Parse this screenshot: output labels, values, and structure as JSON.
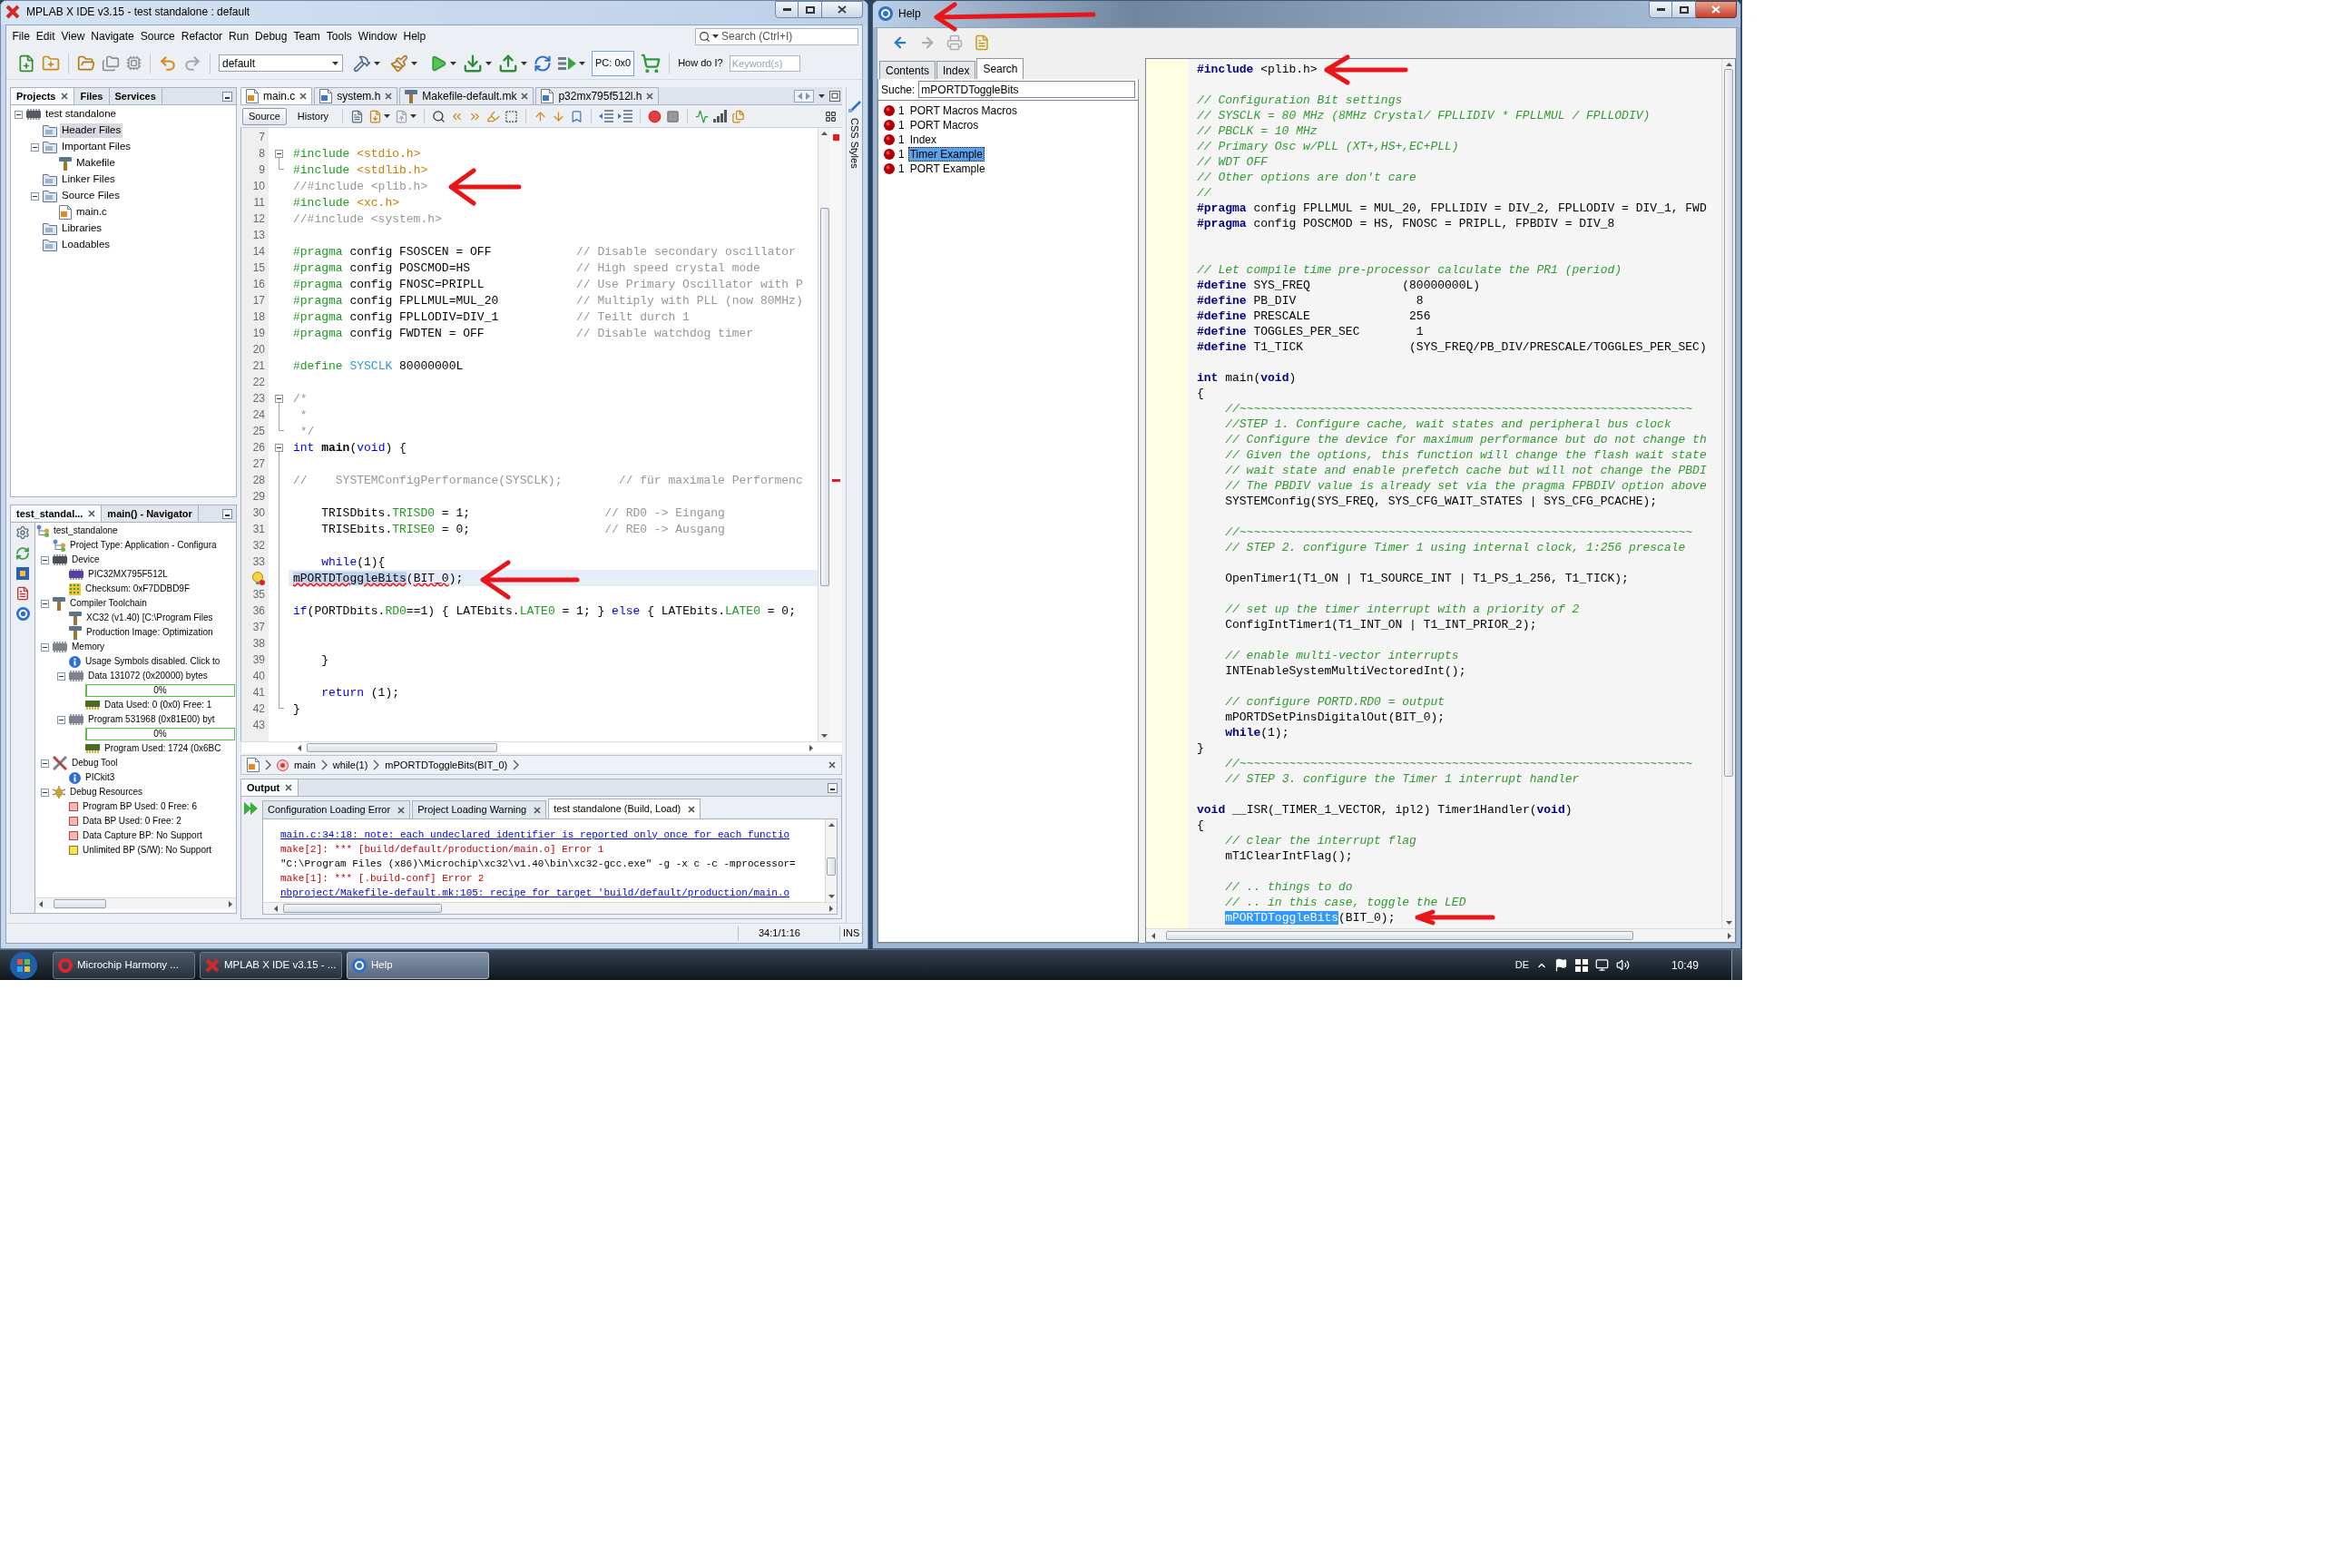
{
  "ide_window": {
    "active": false,
    "title": "MPLAB X IDE v3.15 - test standalone : default",
    "menu": [
      "File",
      "Edit",
      "View",
      "Navigate",
      "Source",
      "Refactor",
      "Run",
      "Debug",
      "Team",
      "Tools",
      "Window",
      "Help"
    ],
    "search": {
      "placeholder": "Search (Ctrl+I)"
    },
    "toolbar": {
      "configuration": "default",
      "pc": "PC: 0x0",
      "help_label": "How do I?",
      "keyword": {
        "placeholder": "Keyword(s)"
      }
    },
    "projects": {
      "tabs": [
        {
          "label": "Projects",
          "selected": true
        },
        {
          "label": "Files",
          "selected": false
        },
        {
          "label": "Services",
          "selected": false
        }
      ],
      "tree": [
        {
          "label": "test standalone",
          "kind": "project",
          "selected": false,
          "expanded": true,
          "children": [
            {
              "label": "Header Files",
              "kind": "folder",
              "selected": true
            },
            {
              "label": "Important Files",
              "kind": "folder",
              "selected": false,
              "expanded": true,
              "children": [
                {
                  "label": "Makefile",
                  "kind": "makefile",
                  "selected": false
                }
              ]
            },
            {
              "label": "Linker Files",
              "kind": "folder",
              "selected": false
            },
            {
              "label": "Source Files",
              "kind": "folder",
              "selected": false,
              "expanded": true,
              "children": [
                {
                  "label": "main.c",
                  "kind": "c-file",
                  "selected": false
                }
              ]
            },
            {
              "label": "Libraries",
              "kind": "folder",
              "selected": false
            },
            {
              "label": "Loadables",
              "kind": "folder",
              "selected": false
            }
          ]
        }
      ]
    },
    "dashboard": {
      "tabs": [
        {
          "label": "test_standal...",
          "selected": true
        },
        {
          "label": "main() - Navigator",
          "selected": false
        }
      ],
      "tree": [
        {
          "label": "test_standalone",
          "kind": "hierarchy",
          "children": [
            {
              "label": "Project Type: Application - Configura",
              "kind": "hierarchy"
            },
            {
              "label": "Device",
              "kind": "device",
              "expanded": true,
              "children": [
                {
                  "label": "PIC32MX795F512L",
                  "kind": "chip"
                },
                {
                  "label": "Checksum: 0xF7DDBD9F",
                  "kind": "checksum"
                }
              ]
            },
            {
              "label": "Compiler Toolchain",
              "kind": "toolchain",
              "expanded": true,
              "children": [
                {
                  "label": "XC32 (v1.40) [C:\\Program Files",
                  "kind": "toolchain"
                },
                {
                  "label": "Production Image: Optimization",
                  "kind": "toolchain"
                }
              ]
            },
            {
              "label": "Memory",
              "kind": "memory",
              "expanded": true,
              "children": [
                {
                  "label": "Usage Symbols disabled. Click to",
                  "kind": "info"
                },
                {
                  "label": "Data 131072 (0x20000) bytes",
                  "kind": "memory",
                  "expanded": true,
                  "children": [
                    {
                      "kind": "meter",
                      "level": 0,
                      "reading": "0%"
                    },
                    {
                      "label": "Data Used: 0 (0x0) Free: 1",
                      "kind": "usage"
                    }
                  ]
                },
                {
                  "label": "Program 531968 (0x81E00) byt",
                  "kind": "memory",
                  "expanded": true,
                  "children": [
                    {
                      "kind": "meter",
                      "level": 0,
                      "reading": "0%"
                    },
                    {
                      "label": "Program Used: 1724 (0x6BC",
                      "kind": "usage"
                    }
                  ]
                }
              ]
            },
            {
              "label": "Debug Tool",
              "kind": "debug-tool",
              "expanded": true,
              "children": [
                {
                  "label": "PICkit3",
                  "kind": "info"
                }
              ]
            },
            {
              "label": "Debug Resources",
              "kind": "bug",
              "expanded": true,
              "children": [
                {
                  "label": "Program BP Used: 0 Free: 6",
                  "kind": "breakpoint"
                },
                {
                  "label": "Data BP Used: 0 Free: 2",
                  "kind": "breakpoint"
                },
                {
                  "label": "Data Capture BP: No Support",
                  "kind": "breakpoint"
                },
                {
                  "label": "Unlimited BP (S/W): No Support",
                  "kind": "software-breakpoint"
                }
              ]
            }
          ]
        }
      ]
    },
    "editor": {
      "tabs": [
        {
          "label": "main.c",
          "kind": "c-file",
          "selected": true
        },
        {
          "label": "system.h",
          "kind": "header",
          "selected": false
        },
        {
          "label": "Makefile-default.mk",
          "kind": "makefile",
          "selected": false
        },
        {
          "label": "p32mx795f512l.h",
          "kind": "header",
          "selected": false
        }
      ],
      "views": [
        {
          "label": "Source",
          "selected": true
        },
        {
          "label": "History",
          "selected": false
        }
      ],
      "lines": [
        {
          "number": "7",
          "current": false
        },
        {
          "number": "8",
          "fold": {
            "kind": "start"
          },
          "current": false,
          "segments": [
            {
              "kind": "directive",
              "text": "#include "
            },
            {
              "kind": "header",
              "text": "<stdio.h>"
            }
          ]
        },
        {
          "number": "9",
          "fold": {
            "kind": "end"
          },
          "current": false,
          "segments": [
            {
              "kind": "directive",
              "text": "#include "
            },
            {
              "kind": "header",
              "text": "<stdlib.h>"
            }
          ]
        },
        {
          "number": "10",
          "current": false,
          "segments": [
            {
              "kind": "comment",
              "text": "//#include <plib.h>"
            }
          ]
        },
        {
          "number": "11",
          "current": false,
          "segments": [
            {
              "kind": "directive",
              "text": "#include "
            },
            {
              "kind": "header",
              "text": "<xc.h>"
            }
          ]
        },
        {
          "number": "12",
          "current": false,
          "segments": [
            {
              "kind": "comment",
              "text": "//#include <system.h>"
            }
          ]
        },
        {
          "number": "13",
          "current": false
        },
        {
          "number": "14",
          "current": false,
          "segments": [
            {
              "kind": "directive",
              "text": "#pragma"
            },
            {
              "kind": "plain",
              "text": " config FSOSCEN = OFF            "
            },
            {
              "kind": "comment",
              "text": "// Disable secondary oscillator"
            }
          ]
        },
        {
          "number": "15",
          "current": false,
          "segments": [
            {
              "kind": "directive",
              "text": "#pragma"
            },
            {
              "kind": "plain",
              "text": " config POSCMOD=HS               "
            },
            {
              "kind": "comment",
              "text": "// High speed crystal mode"
            }
          ]
        },
        {
          "number": "16",
          "current": false,
          "segments": [
            {
              "kind": "directive",
              "text": "#pragma"
            },
            {
              "kind": "plain",
              "text": " config FNOSC=PRIPLL             "
            },
            {
              "kind": "comment",
              "text": "// Use Primary Oscillator with P"
            }
          ]
        },
        {
          "number": "17",
          "current": false,
          "segments": [
            {
              "kind": "directive",
              "text": "#pragma"
            },
            {
              "kind": "plain",
              "text": " config FPLLMUL=MUL_20           "
            },
            {
              "kind": "comment",
              "text": "// Multiply with PLL (now 80MHz)"
            }
          ]
        },
        {
          "number": "18",
          "current": false,
          "segments": [
            {
              "kind": "directive",
              "text": "#pragma"
            },
            {
              "kind": "plain",
              "text": " config FPLLODIV=DIV_1           "
            },
            {
              "kind": "comment",
              "text": "// Teilt durch 1"
            }
          ]
        },
        {
          "number": "19",
          "current": false,
          "segments": [
            {
              "kind": "directive",
              "text": "#pragma"
            },
            {
              "kind": "plain",
              "text": " config FWDTEN = OFF             "
            },
            {
              "kind": "comment",
              "text": "// Disable watchdog timer"
            }
          ]
        },
        {
          "number": "20",
          "current": false
        },
        {
          "number": "21",
          "current": false,
          "segments": [
            {
              "kind": "directive",
              "text": "#define "
            },
            {
              "kind": "macro",
              "text": "SYSCLK"
            },
            {
              "kind": "plain",
              "text": " 80000000L"
            }
          ]
        },
        {
          "number": "22",
          "current": false
        },
        {
          "number": "23",
          "fold": {
            "kind": "start"
          },
          "current": false,
          "segments": [
            {
              "kind": "comment",
              "text": "/*"
            }
          ]
        },
        {
          "number": "24",
          "fold": {
            "kind": "line"
          },
          "current": false,
          "segments": [
            {
              "kind": "comment",
              "text": " *"
            }
          ]
        },
        {
          "number": "25",
          "fold": {
            "kind": "end"
          },
          "current": false,
          "segments": [
            {
              "kind": "comment",
              "text": " */"
            }
          ]
        },
        {
          "number": "26",
          "fold": {
            "kind": "start"
          },
          "current": false,
          "segments": [
            {
              "kind": "keyword",
              "text": "int "
            },
            {
              "kind": "function",
              "text": "main"
            },
            {
              "kind": "plain",
              "text": "("
            },
            {
              "kind": "keyword",
              "text": "void"
            },
            {
              "kind": "plain",
              "text": ") {"
            }
          ]
        },
        {
          "number": "27",
          "fold": {
            "kind": "line"
          },
          "current": false
        },
        {
          "number": "28",
          "fold": {
            "kind": "line"
          },
          "current": false,
          "segments": [
            {
              "kind": "comment",
              "text": "//    SYSTEMConfigPerformance(SYSCLK);        // für maximale Performenc"
            }
          ]
        },
        {
          "number": "29",
          "fold": {
            "kind": "line"
          },
          "current": false
        },
        {
          "number": "30",
          "fold": {
            "kind": "line"
          },
          "current": false,
          "segments": [
            {
              "kind": "plain",
              "text": "    TRISDbits."
            },
            {
              "kind": "field",
              "text": "TRISD0"
            },
            {
              "kind": "plain",
              "text": " = 1;                   "
            },
            {
              "kind": "comment",
              "text": "// RD0 -> Eingang"
            }
          ]
        },
        {
          "number": "31",
          "fold": {
            "kind": "line"
          },
          "current": false,
          "segments": [
            {
              "kind": "plain",
              "text": "    TRISEbits."
            },
            {
              "kind": "field",
              "text": "TRISE0"
            },
            {
              "kind": "plain",
              "text": " = 0;                   "
            },
            {
              "kind": "comment",
              "text": "// RE0 -> Ausgang"
            }
          ]
        },
        {
          "number": "32",
          "fold": {
            "kind": "line"
          },
          "current": false
        },
        {
          "number": "33",
          "fold": {
            "kind": "line"
          },
          "current": false,
          "segments": [
            {
              "kind": "keyword",
              "text": "    while"
            },
            {
              "kind": "plain",
              "text": "(1){"
            }
          ]
        },
        {
          "marker": {
            "kind": "hint"
          },
          "fold": {
            "kind": "line"
          },
          "current": true,
          "segments": [
            {
              "kind": "marked-error",
              "text": "mPORTDToggleBits"
            },
            {
              "kind": "plain",
              "text": "("
            },
            {
              "kind": "error",
              "text": "BIT_0"
            },
            {
              "kind": "plain",
              "text": ");"
            }
          ]
        },
        {
          "number": "35",
          "fold": {
            "kind": "line"
          },
          "current": false
        },
        {
          "number": "36",
          "fold": {
            "kind": "line"
          },
          "current": false,
          "segments": [
            {
              "kind": "keyword",
              "text": "if"
            },
            {
              "kind": "plain",
              "text": "(PORTDbits."
            },
            {
              "kind": "field",
              "text": "RD0"
            },
            {
              "kind": "plain",
              "text": "==1) { LATEbits."
            },
            {
              "kind": "field",
              "text": "LATE0"
            },
            {
              "kind": "plain",
              "text": " = 1; } "
            },
            {
              "kind": "keyword",
              "text": "else"
            },
            {
              "kind": "plain",
              "text": " { LATEbits."
            },
            {
              "kind": "field",
              "text": "LATE0"
            },
            {
              "kind": "plain",
              "text": " = 0;"
            }
          ]
        },
        {
          "number": "37",
          "fold": {
            "kind": "line"
          },
          "current": false
        },
        {
          "number": "38",
          "fold": {
            "kind": "line"
          },
          "current": false
        },
        {
          "number": "39",
          "fold": {
            "kind": "line"
          },
          "current": false,
          "segments": [
            {
              "kind": "plain",
              "text": "    }"
            }
          ]
        },
        {
          "number": "40",
          "fold": {
            "kind": "line"
          },
          "current": false
        },
        {
          "number": "41",
          "fold": {
            "kind": "line"
          },
          "current": false,
          "segments": [
            {
              "kind": "keyword",
              "text": "    return"
            },
            {
              "kind": "plain",
              "text": " (1);"
            }
          ]
        },
        {
          "number": "42",
          "fold": {
            "kind": "end"
          },
          "current": false,
          "segments": [
            {
              "kind": "plain",
              "text": "}"
            }
          ]
        },
        {
          "number": "43",
          "current": false
        }
      ],
      "breadcrumb": [
        {
          "label": "main",
          "kind": "function"
        },
        {
          "label": "while(1)",
          "kind": "statement"
        },
        {
          "label": "mPORTDToggleBits(BIT_0)",
          "kind": "statement"
        }
      ]
    },
    "side_panel": {
      "label": "CSS Styles"
    },
    "output": {
      "title": "Output",
      "tabs": [
        {
          "label": "Configuration Loading Error",
          "selected": false
        },
        {
          "label": "Project Loading Warning",
          "selected": false
        },
        {
          "label": "test standalone (Build, Load)",
          "selected": true
        }
      ],
      "lines": [
        {
          "kind": "link",
          "text": "main.c:34:18: note: each undeclared identifier is reported only once for each functio"
        },
        {
          "kind": "error",
          "text": "make[2]: *** [build/default/production/main.o] Error 1"
        },
        {
          "kind": "plain",
          "text": "\"C:\\Program Files (x86)\\Microchip\\xc32\\v1.40\\bin\\xc32-gcc.exe\" -g -x c -c -mprocessor="
        },
        {
          "kind": "error",
          "text": "make[1]: *** [.build-conf] Error 2"
        },
        {
          "kind": "link",
          "text": "nbproject/Makefile-default.mk:105: recipe for target 'build/default/production/main.o"
        }
      ]
    },
    "status_bar": {
      "position": "34:1/1:16",
      "mode": "INS"
    }
  },
  "help_window": {
    "active": true,
    "title": "Help",
    "toolbar": [
      {
        "kind": "back",
        "disabled": false
      },
      {
        "kind": "forward",
        "disabled": true
      },
      {
        "kind": "print",
        "disabled": true
      },
      {
        "kind": "page-setup",
        "disabled": false
      }
    ],
    "tabs": [
      {
        "label": "Contents",
        "selected": false
      },
      {
        "label": "Index",
        "selected": false
      },
      {
        "label": "Search",
        "selected": true
      }
    ],
    "search": {
      "label": "Suche:",
      "value": "mPORTDToggleBits"
    },
    "results": [
      {
        "count": "1",
        "label": "PORT Macros Macros",
        "selected": false
      },
      {
        "count": "1",
        "label": "PORT Macros",
        "selected": false
      },
      {
        "count": "1",
        "label": "Index",
        "selected": false
      },
      {
        "count": "1",
        "label": "Timer Example",
        "selected": true
      },
      {
        "count": "1",
        "label": "PORT Example",
        "selected": false
      }
    ],
    "lines": [
      {
        "kind": "code",
        "segments": [
          {
            "kind": "keyword",
            "text": "#include"
          },
          {
            "kind": "plain",
            "text": " <plib.h>"
          }
        ]
      },
      {
        "kind": "blank"
      },
      {
        "kind": "code",
        "segments": [
          {
            "kind": "comment",
            "text": "// Configuration Bit settings"
          }
        ]
      },
      {
        "kind": "code",
        "segments": [
          {
            "kind": "comment",
            "text": "// SYSCLK = 80 MHz (8MHz Crystal/ FPLLIDIV * FPLLMUL / FPLLODIV)"
          }
        ]
      },
      {
        "kind": "code",
        "segments": [
          {
            "kind": "comment",
            "text": "// PBCLK = 10 MHz"
          }
        ]
      },
      {
        "kind": "code",
        "segments": [
          {
            "kind": "comment",
            "text": "// Primary Osc w/PLL (XT+,HS+,EC+PLL)"
          }
        ]
      },
      {
        "kind": "code",
        "segments": [
          {
            "kind": "comment",
            "text": "// WDT OFF"
          }
        ]
      },
      {
        "kind": "code",
        "segments": [
          {
            "kind": "comment",
            "text": "// Other options are don't care"
          }
        ]
      },
      {
        "kind": "code",
        "segments": [
          {
            "kind": "comment",
            "text": "//"
          }
        ]
      },
      {
        "kind": "code",
        "segments": [
          {
            "kind": "keyword",
            "text": "#pragma"
          },
          {
            "kind": "plain",
            "text": " config FPLLMUL = MUL_20, FPLLIDIV = DIV_2, FPLLODIV = DIV_1, FWD"
          }
        ]
      },
      {
        "kind": "code",
        "segments": [
          {
            "kind": "keyword",
            "text": "#pragma"
          },
          {
            "kind": "plain",
            "text": " config POSCMOD = HS, FNOSC = PRIPLL, FPBDIV = DIV_8"
          }
        ]
      },
      {
        "kind": "blank"
      },
      {
        "kind": "blank"
      },
      {
        "kind": "code",
        "segments": [
          {
            "kind": "comment",
            "text": "// Let compile time pre-processor calculate the PR1 (period)"
          }
        ]
      },
      {
        "kind": "code",
        "segments": [
          {
            "kind": "keyword",
            "text": "#define"
          },
          {
            "kind": "plain",
            "text": " SYS_FREQ             (80000000L)"
          }
        ]
      },
      {
        "kind": "code",
        "segments": [
          {
            "kind": "keyword",
            "text": "#define"
          },
          {
            "kind": "plain",
            "text": " PB_DIV                 8"
          }
        ]
      },
      {
        "kind": "code",
        "segments": [
          {
            "kind": "keyword",
            "text": "#define"
          },
          {
            "kind": "plain",
            "text": " PRESCALE              256"
          }
        ]
      },
      {
        "kind": "code",
        "segments": [
          {
            "kind": "keyword",
            "text": "#define"
          },
          {
            "kind": "plain",
            "text": " TOGGLES_PER_SEC        1"
          }
        ]
      },
      {
        "kind": "code",
        "segments": [
          {
            "kind": "keyword",
            "text": "#define"
          },
          {
            "kind": "plain",
            "text": " T1_TICK               (SYS_FREQ/PB_DIV/PRESCALE/TOGGLES_PER_SEC)"
          }
        ]
      },
      {
        "kind": "blank"
      },
      {
        "kind": "code",
        "segments": [
          {
            "kind": "keyword",
            "text": "int"
          },
          {
            "kind": "plain",
            "text": " main("
          },
          {
            "kind": "keyword",
            "text": "void"
          },
          {
            "kind": "plain",
            "text": ")"
          }
        ]
      },
      {
        "kind": "code",
        "segments": [
          {
            "kind": "plain",
            "text": "{"
          }
        ]
      },
      {
        "kind": "code",
        "segments": [
          {
            "kind": "comment",
            "text": "    //~~~~~~~~~~~~~~~~~~~~~~~~~~~~~~~~~~~~~~~~~~~~~~~~~~~~~~~~~~~~~~~~"
          }
        ]
      },
      {
        "kind": "code",
        "segments": [
          {
            "kind": "comment",
            "text": "    //STEP 1. Configure cache, wait states and peripheral bus clock"
          }
        ]
      },
      {
        "kind": "code",
        "segments": [
          {
            "kind": "comment",
            "text": "    // Configure the device for maximum performance but do not change th"
          }
        ]
      },
      {
        "kind": "code",
        "segments": [
          {
            "kind": "comment",
            "text": "    // Given the options, this function will change the flash wait state"
          }
        ]
      },
      {
        "kind": "code",
        "segments": [
          {
            "kind": "comment",
            "text": "    // wait state and enable prefetch cache but will not change the PBDI"
          }
        ]
      },
      {
        "kind": "code",
        "segments": [
          {
            "kind": "comment",
            "text": "    // The PBDIV value is already set via the pragma FPBDIV option above"
          }
        ]
      },
      {
        "kind": "code",
        "segments": [
          {
            "kind": "plain",
            "text": "    SYSTEMConfig(SYS_FREQ, SYS_CFG_WAIT_STATES | SYS_CFG_PCACHE);"
          }
        ]
      },
      {
        "kind": "blank"
      },
      {
        "kind": "code",
        "segments": [
          {
            "kind": "comment",
            "text": "    //~~~~~~~~~~~~~~~~~~~~~~~~~~~~~~~~~~~~~~~~~~~~~~~~~~~~~~~~~~~~~~~~"
          }
        ]
      },
      {
        "kind": "code",
        "segments": [
          {
            "kind": "comment",
            "text": "    // STEP 2. configure Timer 1 using internal clock, 1:256 prescale"
          }
        ]
      },
      {
        "kind": "blank"
      },
      {
        "kind": "code",
        "segments": [
          {
            "kind": "plain",
            "text": "    OpenTimer1(T1_ON | T1_SOURCE_INT | T1_PS_1_256, T1_TICK);"
          }
        ]
      },
      {
        "kind": "blank"
      },
      {
        "kind": "code",
        "segments": [
          {
            "kind": "comment",
            "text": "    // set up the timer interrupt with a priority of 2"
          }
        ]
      },
      {
        "kind": "code",
        "segments": [
          {
            "kind": "plain",
            "text": "    ConfigIntTimer1(T1_INT_ON | T1_INT_PRIOR_2);"
          }
        ]
      },
      {
        "kind": "blank"
      },
      {
        "kind": "code",
        "segments": [
          {
            "kind": "comment",
            "text": "    // enable multi-vector interrupts"
          }
        ]
      },
      {
        "kind": "code",
        "segments": [
          {
            "kind": "plain",
            "text": "    INTEnableSystemMultiVectoredInt();"
          }
        ]
      },
      {
        "kind": "blank"
      },
      {
        "kind": "code",
        "segments": [
          {
            "kind": "comment",
            "text": "    // configure PORTD.RD0 = output"
          }
        ]
      },
      {
        "kind": "code",
        "segments": [
          {
            "kind": "plain",
            "text": "    mPORTDSetPinsDigitalOut(BIT_0);"
          }
        ]
      },
      {
        "kind": "code",
        "segments": [
          {
            "kind": "keyword",
            "text": "    while"
          },
          {
            "kind": "plain",
            "text": "(1);"
          }
        ]
      },
      {
        "kind": "code",
        "segments": [
          {
            "kind": "plain",
            "text": "}"
          }
        ]
      },
      {
        "kind": "code",
        "segments": [
          {
            "kind": "comment",
            "text": "    //~~~~~~~~~~~~~~~~~~~~~~~~~~~~~~~~~~~~~~~~~~~~~~~~~~~~~~~~~~~~~~~~"
          }
        ]
      },
      {
        "kind": "code",
        "segments": [
          {
            "kind": "comment",
            "text": "    // STEP 3. configure the Timer 1 interrupt handler"
          }
        ]
      },
      {
        "kind": "blank"
      },
      {
        "kind": "code",
        "segments": [
          {
            "kind": "keyword",
            "text": "void"
          },
          {
            "kind": "plain",
            "text": " __ISR(_TIMER_1_VECTOR, ipl2) Timer1Handler("
          },
          {
            "kind": "keyword",
            "text": "void"
          },
          {
            "kind": "plain",
            "text": ")"
          }
        ]
      },
      {
        "kind": "code",
        "segments": [
          {
            "kind": "plain",
            "text": "{"
          }
        ]
      },
      {
        "kind": "code",
        "segments": [
          {
            "kind": "comment",
            "text": "    // clear the interrupt flag"
          }
        ]
      },
      {
        "kind": "code",
        "segments": [
          {
            "kind": "plain",
            "text": "    mT1ClearIntFlag();"
          }
        ]
      },
      {
        "kind": "blank"
      },
      {
        "kind": "code",
        "segments": [
          {
            "kind": "comment",
            "text": "    // .. things to do"
          }
        ]
      },
      {
        "kind": "code",
        "segments": [
          {
            "kind": "comment",
            "text": "    // .. in this case, toggle the LED"
          }
        ]
      },
      {
        "kind": "code",
        "segments": [
          {
            "kind": "selected",
            "text": "    mPORTDToggleBits"
          },
          {
            "kind": "plain",
            "text": "(BIT_0);"
          }
        ]
      }
    ]
  },
  "taskbar": {
    "tasks": [
      {
        "label": "Microchip Harmony ...",
        "kind": "browser",
        "selected": false
      },
      {
        "label": "MPLAB X IDE v3.15 - ...",
        "kind": "ide",
        "selected": false
      },
      {
        "label": "Help",
        "kind": "help",
        "selected": true
      }
    ],
    "language": "DE",
    "clock": "10:49"
  }
}
